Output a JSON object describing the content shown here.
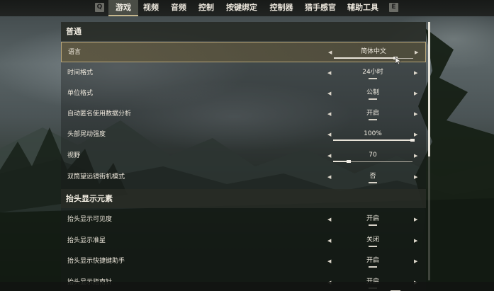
{
  "nav": {
    "left_key": "Q",
    "right_key": "E",
    "tabs": [
      {
        "label": "游戏",
        "active": true
      },
      {
        "label": "视频"
      },
      {
        "label": "音频"
      },
      {
        "label": "控制"
      },
      {
        "label": "按键绑定"
      },
      {
        "label": "控制器"
      },
      {
        "label": "猎手感官"
      },
      {
        "label": "辅助工具"
      }
    ]
  },
  "sections": [
    {
      "title": "普通",
      "rows": [
        {
          "label": "语言",
          "value": "简体中文",
          "selected": true,
          "kind": "slider",
          "level": 0.78
        },
        {
          "label": "时间格式",
          "value": "24小时",
          "kind": "tick"
        },
        {
          "label": "单位格式",
          "value": "公制",
          "kind": "tick"
        },
        {
          "label": "自动匿名使用数据分析",
          "value": "开启",
          "kind": "tick"
        },
        {
          "label": "头部晃动强度",
          "value": "100%",
          "kind": "slider",
          "level": 1.0
        },
        {
          "label": "视野",
          "value": "70",
          "kind": "slider",
          "level": 0.2
        },
        {
          "label": "双筒望远镜街机模式",
          "value": "否",
          "kind": "tick"
        }
      ]
    },
    {
      "title": "抬头显示元素",
      "rows": [
        {
          "label": "抬头显示可见度",
          "value": "开启",
          "kind": "tick"
        },
        {
          "label": "抬头显示准星",
          "value": "关闭",
          "kind": "tick"
        },
        {
          "label": "抬头显示快捷键助手",
          "value": "开启",
          "kind": "tick"
        },
        {
          "label": "抬头显示指南针",
          "value": "开启",
          "kind": "tick"
        }
      ]
    }
  ],
  "scroll": {
    "position": 0.0,
    "visible_fraction": 0.52
  },
  "icons": {
    "left_arrow": "left-arrow-icon",
    "right_arrow": "right-arrow-icon"
  }
}
